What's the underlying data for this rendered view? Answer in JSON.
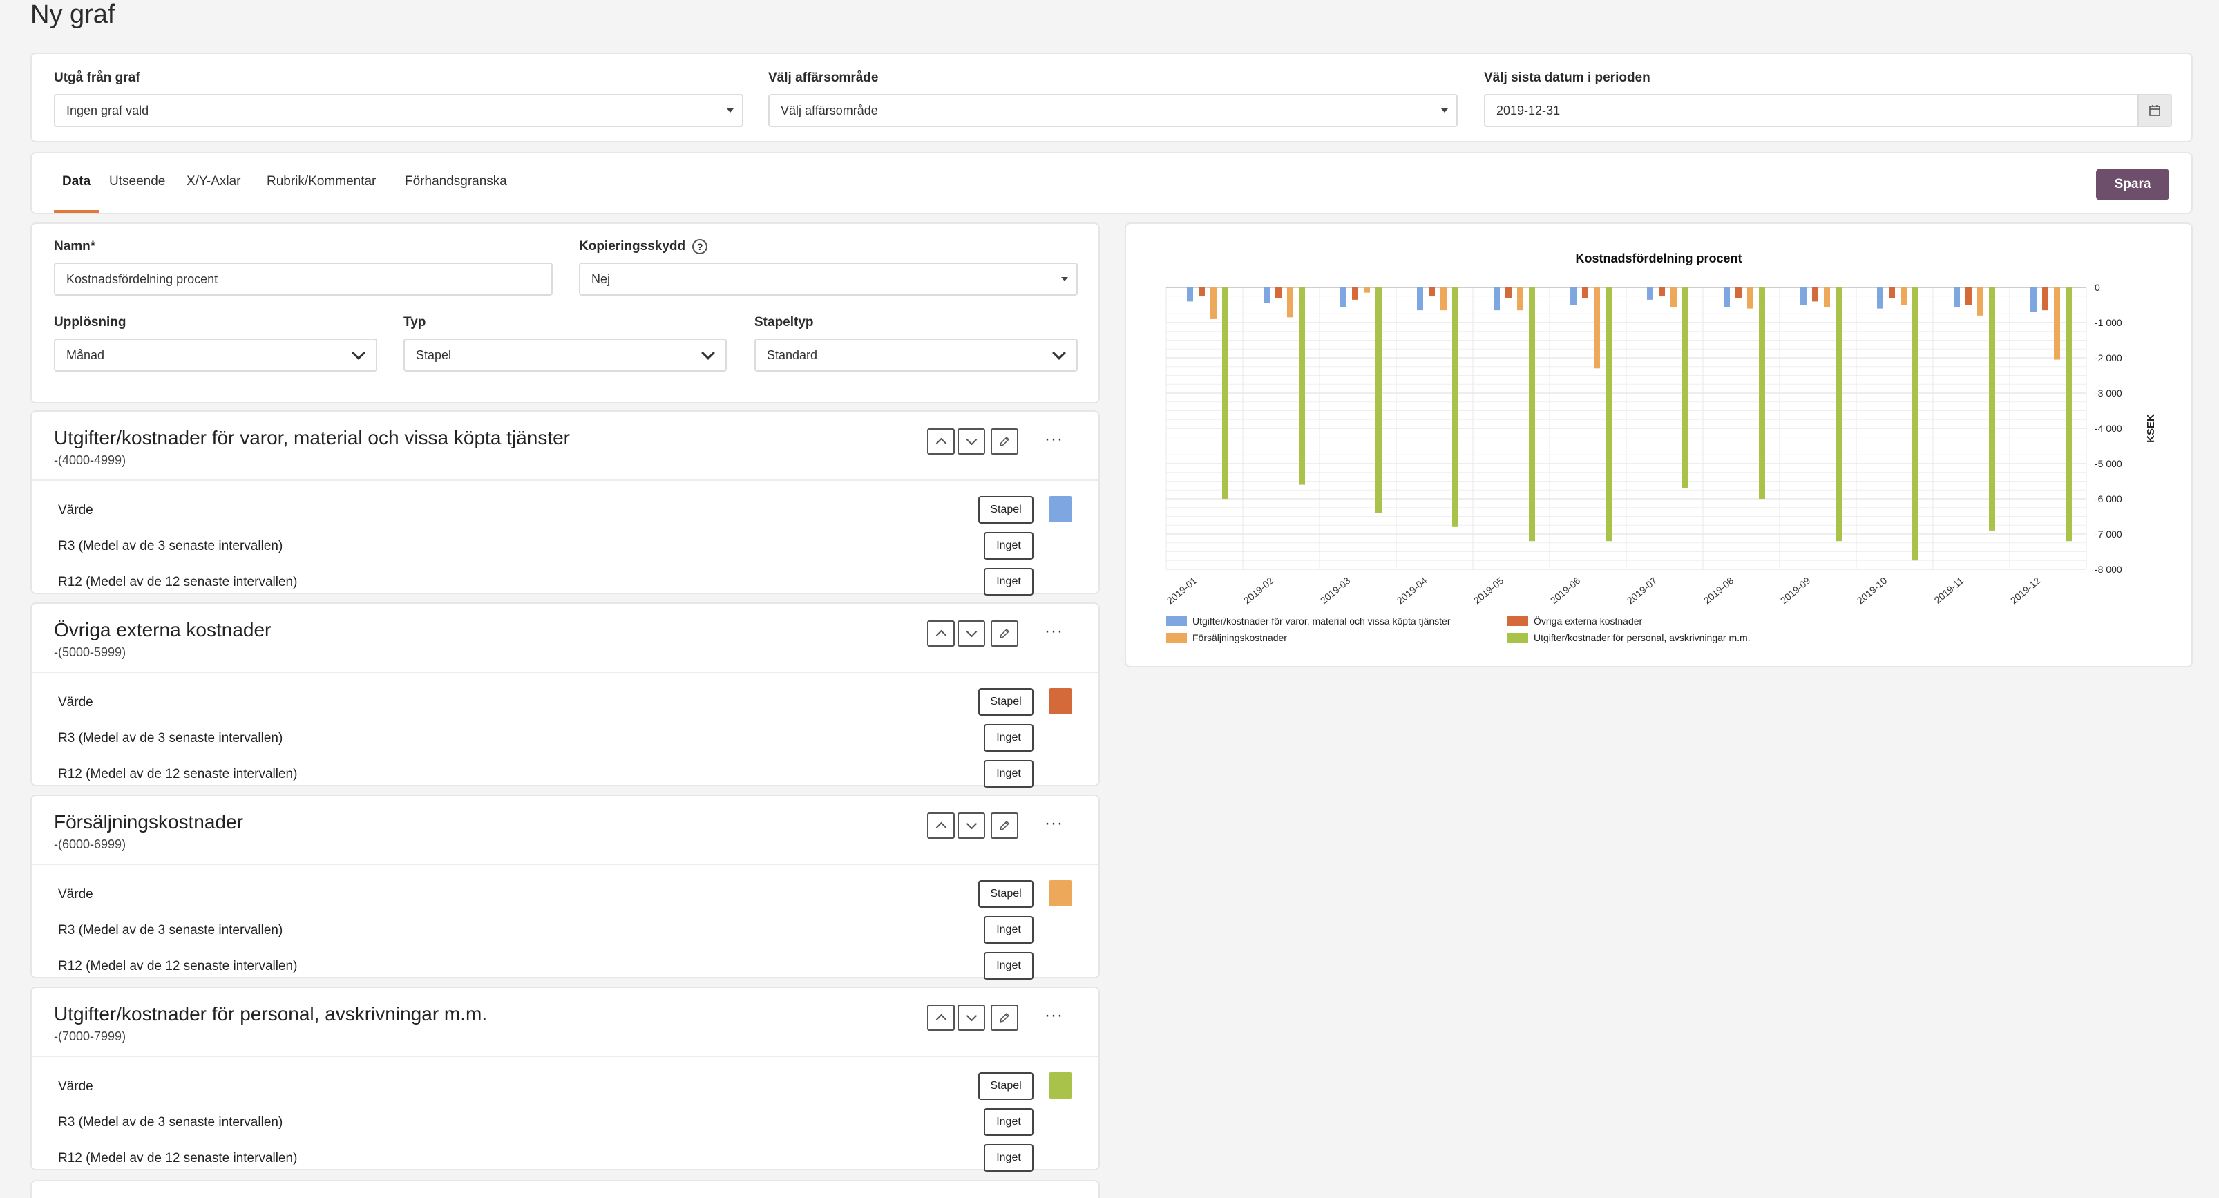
{
  "page": {
    "title": "Ny graf"
  },
  "selectors": {
    "from_graph": {
      "label": "Utgå från graf",
      "value": "Ingen graf vald"
    },
    "business_area": {
      "label": "Välj affärsområde",
      "value": "Välj affärsområde"
    },
    "last_date": {
      "label": "Välj sista datum i perioden",
      "value": "2019-12-31"
    }
  },
  "tabs": [
    {
      "label": "Data",
      "active": true
    },
    {
      "label": "Utseende"
    },
    {
      "label": "X/Y-Axlar"
    },
    {
      "label": "Rubrik/Kommentar"
    },
    {
      "label": "Förhandsgranska"
    }
  ],
  "save_label": "Spara",
  "form": {
    "name": {
      "label": "Namn*",
      "value": "Kostnadsfördelning procent"
    },
    "copy_protection": {
      "label": "Kopieringsskydd",
      "value": "Nej",
      "help": "?"
    },
    "resolution": {
      "label": "Upplösning",
      "value": "Månad"
    },
    "type": {
      "label": "Typ",
      "value": "Stapel"
    },
    "bar_type": {
      "label": "Stapeltyp",
      "value": "Standard"
    }
  },
  "series": [
    {
      "title": "Utgifter/kostnader för varor, material och vissa köpta tjänster",
      "range": "-(4000-4999)",
      "color": "#7ea6e0",
      "rows": [
        {
          "label": "Värde",
          "button": "Stapel"
        },
        {
          "label": "R3 (Medel av de 3 senaste intervallen)",
          "button": "Inget"
        },
        {
          "label": "R12 (Medel av de 12 senaste intervallen)",
          "button": "Inget"
        }
      ]
    },
    {
      "title": "Övriga externa kostnader",
      "range": "-(5000-5999)",
      "color": "#d4693a",
      "rows": [
        {
          "label": "Värde",
          "button": "Stapel"
        },
        {
          "label": "R3 (Medel av de 3 senaste intervallen)",
          "button": "Inget"
        },
        {
          "label": "R12 (Medel av de 12 senaste intervallen)",
          "button": "Inget"
        }
      ]
    },
    {
      "title": "Försäljningskostnader",
      "range": "-(6000-6999)",
      "color": "#eda85a",
      "rows": [
        {
          "label": "Värde",
          "button": "Stapel"
        },
        {
          "label": "R3 (Medel av de 3 senaste intervallen)",
          "button": "Inget"
        },
        {
          "label": "R12 (Medel av de 12 senaste intervallen)",
          "button": "Inget"
        }
      ]
    },
    {
      "title": "Utgifter/kostnader för personal, avskrivningar m.m.",
      "range": "-(7000-7999)",
      "color": "#a8c24a",
      "rows": [
        {
          "label": "Värde",
          "button": "Stapel"
        },
        {
          "label": "R3 (Medel av de 3 senaste intervallen)",
          "button": "Inget"
        },
        {
          "label": "R12 (Medel av de 12 senaste intervallen)",
          "button": "Inget"
        }
      ]
    }
  ],
  "chart_data": {
    "type": "bar",
    "title": "Kostnadsfördelning procent",
    "ylabel": "KSEK",
    "ylim": [
      -8000,
      0
    ],
    "yticks": [
      0,
      -1000,
      -2000,
      -3000,
      -4000,
      -5000,
      -6000,
      -7000,
      -8000
    ],
    "ytick_labels": [
      "0",
      "-1 000",
      "-2 000",
      "-3 000",
      "-4 000",
      "-5 000",
      "-6 000",
      "-7 000",
      "-8 000"
    ],
    "categories": [
      "2019-01",
      "2019-02",
      "2019-03",
      "2019-04",
      "2019-05",
      "2019-06",
      "2019-07",
      "2019-08",
      "2019-09",
      "2019-10",
      "2019-11",
      "2019-12"
    ],
    "series": [
      {
        "name": "Utgifter/kostnader för varor, material och vissa köpta tjänster",
        "color": "#7ea6e0",
        "values": [
          -400,
          -450,
          -550,
          -650,
          -650,
          -500,
          -350,
          -550,
          -500,
          -600,
          -550,
          -700
        ]
      },
      {
        "name": "Övriga externa kostnader",
        "color": "#d4693a",
        "values": [
          -250,
          -300,
          -350,
          -250,
          -300,
          -300,
          -250,
          -300,
          -400,
          -300,
          -500,
          -650
        ]
      },
      {
        "name": "Försäljningskostnader",
        "color": "#eda85a",
        "values": [
          -900,
          -850,
          -150,
          -650,
          -650,
          -2300,
          -550,
          -600,
          -550,
          -500,
          -800,
          -2050
        ]
      },
      {
        "name": "Utgifter/kostnader för personal, avskrivningar m.m.",
        "color": "#a8c24a",
        "values": [
          -6000,
          -5600,
          -6400,
          -6800,
          -7200,
          -7200,
          -5700,
          -6000,
          -7200,
          -7750,
          -6900,
          -7200
        ]
      }
    ],
    "legend_position": "bottom-left",
    "grid": true
  }
}
